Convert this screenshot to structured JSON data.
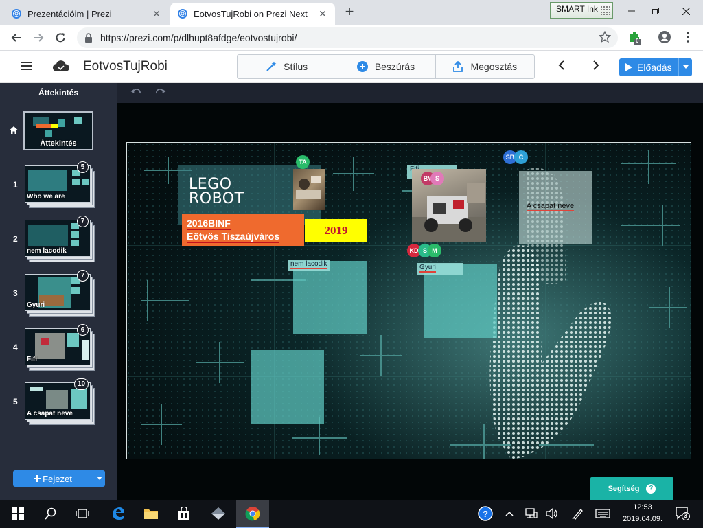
{
  "browser": {
    "tabs": [
      {
        "title": "Prezentációim | Prezi",
        "close": "✕"
      },
      {
        "title": "EotvosTujRobi on Prezi Next",
        "close": "✕"
      }
    ],
    "new_tab": "+",
    "url": "https://prezi.com/p/dlhupt8afdge/eotvostujrobi/",
    "extension_badge": "0",
    "smart_ink": "SMART Ink"
  },
  "prezi": {
    "title": "EotvosTujRobi",
    "toolbar": {
      "style": "Stílus",
      "insert": "Beszúrás",
      "share": "Megosztás"
    },
    "present": "Előadás"
  },
  "sidebar": {
    "header": "Áttekintés",
    "overview_label": "Áttekintés",
    "slides": [
      {
        "num": "1",
        "label": "Who we are",
        "count": "5"
      },
      {
        "num": "2",
        "label": "nem lacodik",
        "count": "7"
      },
      {
        "num": "3",
        "label": "Gyuri",
        "count": "7"
      },
      {
        "num": "4",
        "label": "Fifi",
        "count": "6"
      },
      {
        "num": "5",
        "label": "A csapat neve",
        "count": "10"
      }
    ],
    "add_chapter": "Fejezet"
  },
  "canvas": {
    "title_line1": "LEGO",
    "title_line2": "ROBOT",
    "subtitle_line1": "2016BINF",
    "subtitle_line2": "Eötvös Tiszaújváros",
    "year": "2019",
    "frames": {
      "nem_lacodik": "nem lacodik",
      "gyuri": "Gyuri",
      "fifi": "Fifi",
      "csapat": "A csapat neve"
    },
    "avatars": {
      "ta": "TA",
      "sb": "SB",
      "c": "C",
      "bv": "BV",
      "s1": "S",
      "kd": "KD",
      "s2": "S",
      "m": "M"
    },
    "help": "Segítség",
    "help_icon": "?"
  },
  "taskbar": {
    "time": "12:53",
    "date": "2019.04.09.",
    "notifications": "3"
  },
  "colors": {
    "prezi_blue": "#2e8ae6",
    "sidebar": "#272d3b",
    "teal_frame": "#5ec7c0",
    "orange": "#ef6a2e",
    "yellow": "#ffff00",
    "help": "#1ab3a6"
  }
}
